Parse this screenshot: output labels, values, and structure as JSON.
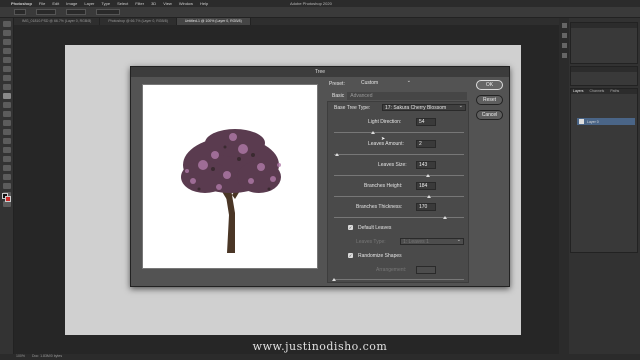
{
  "menubar": {
    "items": [
      "Photoshop",
      "File",
      "Edit",
      "Image",
      "Layer",
      "Type",
      "Select",
      "Filter",
      "3D",
      "View",
      "Window",
      "Help"
    ],
    "title": "Adobe Photoshop 2020"
  },
  "doc_tabs": [
    {
      "label": "IMG_01810.PSD @ 66.7% (Layer 0, RGB/8)",
      "active": false
    },
    {
      "label": "Photoshop @ 66.7% (Layer 0, RGB/8)",
      "active": false
    },
    {
      "label": "Untitled-1 @ 100% (Layer 0, RGB/8)",
      "active": true
    }
  ],
  "dialog": {
    "title": "Tree",
    "preset_label": "Preset:",
    "preset_value": "Custom",
    "tab_basic": "Basic",
    "tab_advanced": "Advanced",
    "base_tree_type_label": "Base Tree Type:",
    "base_tree_type_value": "17: Sakura Cherry Blossom",
    "light_direction_label": "Light Direction:",
    "light_direction_value": "54",
    "leaves_amount_label": "Leaves Amount:",
    "leaves_amount_value": "2",
    "leaves_size_label": "Leaves Size:",
    "leaves_size_value": "143",
    "branches_height_label": "Branches Height:",
    "branches_height_value": "184",
    "branches_thickness_label": "Branches Thickness:",
    "branches_thickness_value": "170",
    "default_leaves_label": "Default Leaves",
    "default_leaves_checked": true,
    "leaves_type_label": "Leaves Type:",
    "leaves_type_value": "1: Leaves 1",
    "randomize_shapes_label": "Randomize Shapes",
    "randomize_shapes_checked": true,
    "arrangement_label": "Arrangement:",
    "arrangement_value": "",
    "ok_label": "OK",
    "reset_label": "Reset",
    "cancel_label": "Cancel",
    "slider_levels": {
      "light_direction": 0.3,
      "leaves_amount": 0.02,
      "leaves_size": 0.72,
      "branches_height": 0.73,
      "branches_thickness": 0.85,
      "arrangement": 0.0
    }
  },
  "layers_panel": {
    "tabs": [
      "Layers",
      "Channels",
      "Paths"
    ],
    "layer_name": "Layer 0"
  },
  "status": {
    "zoom": "100%",
    "doc_size": "Doc: 1.83M/0 bytes"
  },
  "watermark": "www.justinodisho.com",
  "colors": {
    "foreground": "#111111",
    "background": "#c62828",
    "blossom": "#b07aa8"
  }
}
